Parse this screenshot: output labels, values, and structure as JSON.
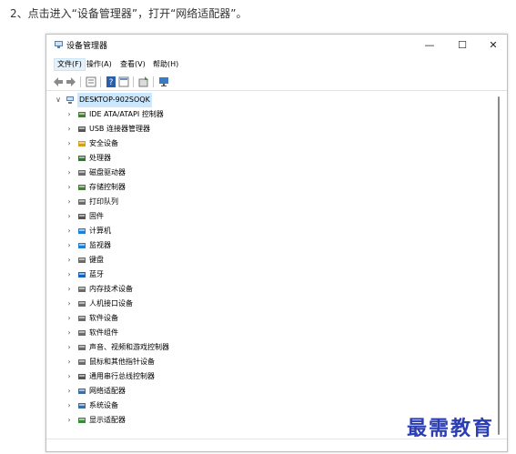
{
  "instruction": "2、点击进入“设备管理器”，打开“网络适配器”。",
  "window": {
    "title": "设备管理器",
    "controls": {
      "minimize": "—",
      "maximize": "☐",
      "close": "✕"
    }
  },
  "menu": [
    {
      "label": "文件(F)"
    },
    {
      "label": "操作(A)"
    },
    {
      "label": "查看(V)"
    },
    {
      "label": "帮助(H)"
    }
  ],
  "toolbar": [
    {
      "icon": "back-arrow-icon"
    },
    {
      "icon": "forward-arrow-icon"
    },
    {
      "icon": "properties-icon"
    },
    {
      "icon": "help-icon"
    },
    {
      "icon": "view-icon"
    },
    {
      "icon": "update-driver-icon"
    },
    {
      "icon": "monitor-icon"
    }
  ],
  "tree": {
    "root": {
      "label": "DESKTOP-902SOQK",
      "expanded": true,
      "chevron": "∨"
    },
    "chevron": "›",
    "items": [
      {
        "label": "IDE ATA/ATAPI 控制器",
        "icon": "ide-controller-icon",
        "color": "#4a7a3a"
      },
      {
        "label": "USB 连接器管理器",
        "icon": "usb-icon",
        "color": "#555555"
      },
      {
        "label": "安全设备",
        "icon": "security-device-icon",
        "color": "#d4a017"
      },
      {
        "label": "处理器",
        "icon": "processor-icon",
        "color": "#3b6e3b"
      },
      {
        "label": "磁盘驱动器",
        "icon": "disk-drive-icon",
        "color": "#6b6b6b"
      },
      {
        "label": "存储控制器",
        "icon": "storage-controller-icon",
        "color": "#4a7a3a"
      },
      {
        "label": "打印队列",
        "icon": "print-queue-icon",
        "color": "#6b6b6b"
      },
      {
        "label": "固件",
        "icon": "firmware-icon",
        "color": "#555555"
      },
      {
        "label": "计算机",
        "icon": "computer-icon",
        "color": "#1e7fd6"
      },
      {
        "label": "监视器",
        "icon": "monitor-icon",
        "color": "#1e7fd6"
      },
      {
        "label": "键盘",
        "icon": "keyboard-icon",
        "color": "#6b6b6b"
      },
      {
        "label": "蓝牙",
        "icon": "bluetooth-icon",
        "color": "#1565c0"
      },
      {
        "label": "内存技术设备",
        "icon": "memory-device-icon",
        "color": "#6b6b6b"
      },
      {
        "label": "人机接口设备",
        "icon": "hid-icon",
        "color": "#6b6b6b"
      },
      {
        "label": "软件设备",
        "icon": "software-device-icon",
        "color": "#6b6b6b"
      },
      {
        "label": "软件组件",
        "icon": "software-component-icon",
        "color": "#6b6b6b"
      },
      {
        "label": "声音、视频和游戏控制器",
        "icon": "speaker-icon",
        "color": "#6b6b6b"
      },
      {
        "label": "鼠标和其他指针设备",
        "icon": "mouse-icon",
        "color": "#6b6b6b"
      },
      {
        "label": "通用串行总线控制器",
        "icon": "usb-controller-icon",
        "color": "#555555"
      },
      {
        "label": "网络适配器",
        "icon": "network-adapter-icon",
        "color": "#3b6e9e"
      },
      {
        "label": "系统设备",
        "icon": "system-device-icon",
        "color": "#3b6e9e"
      },
      {
        "label": "显示适配器",
        "icon": "display-adapter-icon",
        "color": "#3b8a3b"
      }
    ]
  },
  "watermark": "最需教育"
}
